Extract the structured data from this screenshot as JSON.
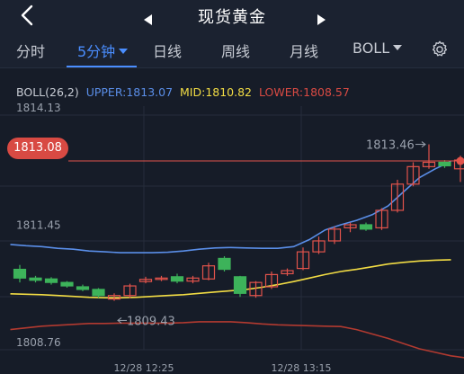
{
  "header": {
    "title": "现货黄金",
    "icons": {
      "back": "back-arrow-icon",
      "prev": "prev-triangle-icon",
      "next": "next-triangle-icon"
    }
  },
  "tabs": [
    {
      "label": "分时",
      "active": false
    },
    {
      "label": "5分钟",
      "active": true,
      "has_caret": true
    },
    {
      "label": "日线",
      "active": false
    },
    {
      "label": "周线",
      "active": false
    },
    {
      "label": "月线",
      "active": false
    },
    {
      "label": "BOLL",
      "active": false,
      "has_caret": true
    }
  ],
  "settings_icon": "gear-icon",
  "indicator": {
    "name": "BOLL(26,2)",
    "upper_label": "UPPER:1813.07",
    "mid_label": "MID:1810.82",
    "lower_label": "LOWER:1808.57"
  },
  "colors": {
    "background": "#161c28",
    "accent": "#4a8eff",
    "up": "#e2534b",
    "down": "#3db35a",
    "upper_band": "#5a8ee8",
    "mid_band": "#f2dc44",
    "lower_band": "#b23a30"
  },
  "current_price": "1813.08",
  "chart_data": {
    "type": "candlestick",
    "y_ticks": [
      "1814.13",
      "1811.45",
      "1808.76"
    ],
    "y_range": [
      1808.76,
      1814.13
    ],
    "x_ticks": [
      "12/28 12:25",
      "12/28 13:15"
    ],
    "annotations": {
      "high": "1813.46",
      "low": "1809.43"
    },
    "candles": [
      {
        "o": 1810.6,
        "c": 1810.4,
        "h": 1810.7,
        "l": 1810.3
      },
      {
        "o": 1810.4,
        "c": 1810.35,
        "h": 1810.45,
        "l": 1810.3
      },
      {
        "o": 1810.38,
        "c": 1810.3,
        "h": 1810.42,
        "l": 1810.25
      },
      {
        "o": 1810.3,
        "c": 1810.22,
        "h": 1810.33,
        "l": 1810.18
      },
      {
        "o": 1810.2,
        "c": 1810.14,
        "h": 1810.25,
        "l": 1810.1
      },
      {
        "o": 1810.14,
        "c": 1810.0,
        "h": 1810.17,
        "l": 1809.95
      },
      {
        "o": 1809.92,
        "c": 1810.0,
        "h": 1810.05,
        "l": 1809.88
      },
      {
        "o": 1810.0,
        "c": 1810.22,
        "h": 1810.27,
        "l": 1809.94
      },
      {
        "o": 1810.32,
        "c": 1810.37,
        "h": 1810.43,
        "l": 1810.28
      },
      {
        "o": 1810.38,
        "c": 1810.4,
        "h": 1810.45,
        "l": 1810.33
      },
      {
        "o": 1810.43,
        "c": 1810.33,
        "h": 1810.5,
        "l": 1810.28
      },
      {
        "o": 1810.33,
        "c": 1810.4,
        "h": 1810.45,
        "l": 1810.28
      },
      {
        "o": 1810.38,
        "c": 1810.68,
        "h": 1810.75,
        "l": 1810.35
      },
      {
        "o": 1810.85,
        "c": 1810.6,
        "h": 1810.9,
        "l": 1810.55
      },
      {
        "o": 1810.43,
        "c": 1810.05,
        "h": 1810.45,
        "l": 1809.97
      },
      {
        "o": 1810.0,
        "c": 1810.3,
        "h": 1810.33,
        "l": 1809.95
      },
      {
        "o": 1810.2,
        "c": 1810.48,
        "h": 1810.55,
        "l": 1810.15
      },
      {
        "o": 1810.5,
        "c": 1810.57,
        "h": 1810.62,
        "l": 1810.45
      },
      {
        "o": 1810.62,
        "c": 1811.0,
        "h": 1811.1,
        "l": 1810.58
      },
      {
        "o": 1811.0,
        "c": 1811.25,
        "h": 1811.35,
        "l": 1810.95
      },
      {
        "o": 1811.25,
        "c": 1811.52,
        "h": 1811.58,
        "l": 1811.18
      },
      {
        "o": 1811.55,
        "c": 1811.62,
        "h": 1811.67,
        "l": 1811.45
      },
      {
        "o": 1811.62,
        "c": 1811.52,
        "h": 1811.67,
        "l": 1811.48
      },
      {
        "o": 1811.55,
        "c": 1811.95,
        "h": 1812.0,
        "l": 1811.5
      },
      {
        "o": 1811.95,
        "c": 1812.55,
        "h": 1812.65,
        "l": 1811.9
      },
      {
        "o": 1812.55,
        "c": 1812.95,
        "h": 1813.05,
        "l": 1812.5
      },
      {
        "o": 1812.95,
        "c": 1813.05,
        "h": 1813.46,
        "l": 1812.9
      },
      {
        "o": 1813.05,
        "c": 1812.97,
        "h": 1813.1,
        "l": 1812.92
      },
      {
        "o": 1812.9,
        "c": 1813.1,
        "h": 1813.2,
        "l": 1812.6
      }
    ],
    "upper": [
      1811.17,
      1811.14,
      1811.12,
      1811.08,
      1811.06,
      1811.02,
      1811.0,
      1810.98,
      1810.98,
      1810.98,
      1810.99,
      1811.02,
      1811.06,
      1811.09,
      1811.1,
      1811.09,
      1811.08,
      1811.08,
      1811.12,
      1811.28,
      1811.5,
      1811.62,
      1811.72,
      1811.85,
      1812.05,
      1812.38,
      1812.7,
      1812.9,
      1813.07
    ],
    "mid": [
      1810.04,
      1810.03,
      1810.02,
      1810.0,
      1809.98,
      1809.96,
      1809.95,
      1809.95,
      1809.96,
      1809.98,
      1810.0,
      1810.02,
      1810.05,
      1810.08,
      1810.11,
      1810.14,
      1810.19,
      1810.25,
      1810.32,
      1810.4,
      1810.48,
      1810.55,
      1810.6,
      1810.66,
      1810.72,
      1810.76,
      1810.79,
      1810.81,
      1810.82
    ],
    "lower": [
      1809.22,
      1809.26,
      1809.3,
      1809.32,
      1809.34,
      1809.36,
      1809.36,
      1809.37,
      1809.37,
      1809.37,
      1809.37,
      1809.38,
      1809.4,
      1809.4,
      1809.4,
      1809.38,
      1809.35,
      1809.33,
      1809.32,
      1809.31,
      1809.3,
      1809.29,
      1809.22,
      1809.12,
      1809.02,
      1808.9,
      1808.78,
      1808.7,
      1808.62,
      1808.57
    ]
  }
}
